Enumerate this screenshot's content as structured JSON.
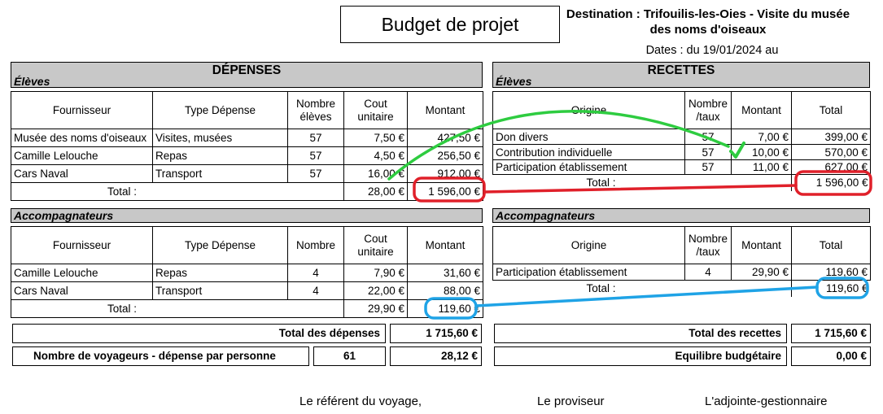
{
  "header": {
    "title": "Budget de projet",
    "destination": "Destination : Trifouilis-les-Oies - Visite du musée des noms d'oiseaux",
    "dates": "Dates : du 19/01/2024 au"
  },
  "depenses": {
    "title": "DÉPENSES",
    "eleves": {
      "label": "Élèves",
      "headers": [
        "Fournisseur",
        "Type Dépense",
        "Nombre élèves",
        "Cout unitaire",
        "Montant"
      ],
      "rows": [
        [
          "Musée des noms d'oiseaux",
          "Visites, musées",
          "57",
          "7,50 €",
          "427,50 €"
        ],
        [
          "Camille Lelouche",
          "Repas",
          "57",
          "4,50 €",
          "256,50 €"
        ],
        [
          "Cars Naval",
          "Transport",
          "57",
          "16,00 €",
          "912,00 €"
        ]
      ],
      "total_label": "Total :",
      "total_unit": "28,00 €",
      "total_amount": "1 596,00 €"
    },
    "accompagnateurs": {
      "label": "Accompagnateurs",
      "headers": [
        "Fournisseur",
        "Type Dépense",
        "Nombre",
        "Cout unitaire",
        "Montant"
      ],
      "rows": [
        [
          "Camille Lelouche",
          "Repas",
          "4",
          "7,90 €",
          "31,60 €"
        ],
        [
          "Cars Naval",
          "Transport",
          "4",
          "22,00 €",
          "88,00 €"
        ]
      ],
      "total_label": "Total :",
      "total_unit": "29,90 €",
      "total_amount": "119,60 €"
    },
    "total_label": "Total des dépenses",
    "total_value": "1 715,60 €",
    "voyageurs_label": "Nombre de voyageurs - dépense par personne",
    "voyageurs_count": "61",
    "voyageurs_per_person": "28,12 €"
  },
  "recettes": {
    "title": "RECETTES",
    "eleves": {
      "label": "Élèves",
      "headers": [
        "Origine",
        "Nombre /taux",
        "Montant",
        "Total"
      ],
      "rows": [
        [
          "Don divers",
          "57",
          "7,00 €",
          "399,00 €"
        ],
        [
          "Contribution individuelle",
          "57",
          "10,00 €",
          "570,00 €"
        ],
        [
          "Participation établissement",
          "57",
          "11,00 €",
          "627,00 €"
        ]
      ],
      "total_label": "Total :",
      "total_amount": "1 596,00 €"
    },
    "accompagnateurs": {
      "label": "Accompagnateurs",
      "headers": [
        "Origine",
        "Nombre /taux",
        "Montant",
        "Total"
      ],
      "rows": [
        [
          "Participation établissement",
          "4",
          "29,90 €",
          "119,60 €"
        ]
      ],
      "total_label": "Total :",
      "total_amount": "119,60 €"
    },
    "total_label": "Total des recettes",
    "total_value": "1 715,60 €",
    "equilibre_label": "Equilibre budgétaire",
    "equilibre_value": "0,00 €"
  },
  "signatures": {
    "referent": "Le référent du voyage,",
    "proviseur": "Le proviseur",
    "gestionnaire": "L'adjointe-gestionnaire"
  },
  "annotation_colors": {
    "green": "#2ecc40",
    "red": "#e0202a",
    "blue": "#1fa3e6"
  }
}
